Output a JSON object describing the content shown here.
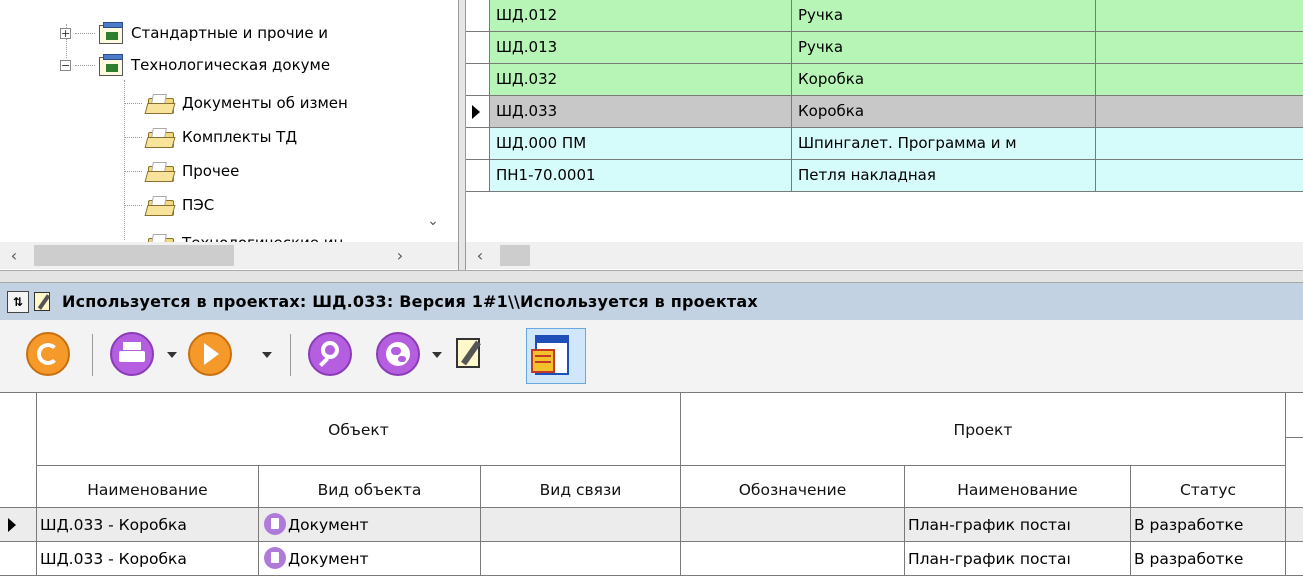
{
  "tree": {
    "items": [
      {
        "label": "Стандартные и прочие и",
        "kind": "catalog",
        "expander": "+"
      },
      {
        "label": "Технологическая докуме",
        "kind": "catalog",
        "expander": "−"
      },
      {
        "label": "Документы об измен",
        "kind": "folder"
      },
      {
        "label": "Комплекты ТД",
        "kind": "folder"
      },
      {
        "label": "Прочее",
        "kind": "folder"
      },
      {
        "label": "ПЭС",
        "kind": "folder"
      },
      {
        "label": "Технологические ин",
        "kind": "folder"
      }
    ]
  },
  "top_grid": {
    "rows": [
      {
        "code": "ШД.012",
        "name": "Ручка",
        "color": "#b6f5b6"
      },
      {
        "code": "ШД.013",
        "name": "Ручка",
        "color": "#b6f5b6"
      },
      {
        "code": "ШД.032",
        "name": "Коробка",
        "color": "#b6f5b6"
      },
      {
        "code": "ШД.033",
        "name": "Коробка",
        "color": "#c8c8c8",
        "selected": true
      },
      {
        "code": "ШД.000 ПМ",
        "name": "Шпингалет. Программа и м",
        "color": "#d6fbfb"
      },
      {
        "code": "ПН1-70.0001",
        "name": "Петля накладная",
        "color": "#d6fbfb"
      }
    ]
  },
  "panel_title": "Используется в проектах: ШД.033: Версия 1#1\\\\Используется в проектах",
  "toolbar": {
    "icons": [
      "refresh-icon",
      "print-icon",
      "run-icon",
      "search-icon",
      "globe-icon",
      "edit-document-icon",
      "report-icon"
    ]
  },
  "bottom_grid": {
    "group_headers": {
      "object": "Объект",
      "project": "Проект"
    },
    "columns": [
      "Наименование",
      "Вид объекта",
      "Вид связи",
      "Обозначение",
      "Наименование",
      "Статус"
    ],
    "rows": [
      {
        "name": "ШД.033 - Коробка",
        "object_type": "Документ",
        "link_type": "",
        "designation": "",
        "project_name": "План-график постаı",
        "status": "В разработке",
        "selected": true
      },
      {
        "name": "ШД.033 - Коробка",
        "object_type": "Документ",
        "link_type": "",
        "designation": "",
        "project_name": "План-график постаı",
        "status": "В разработке"
      }
    ]
  },
  "colors": {
    "title_bar": "#c3d2e2",
    "green_row": "#b6f5b6",
    "cyan_row": "#d6fbfb",
    "selected_row": "#c8c8c8"
  }
}
